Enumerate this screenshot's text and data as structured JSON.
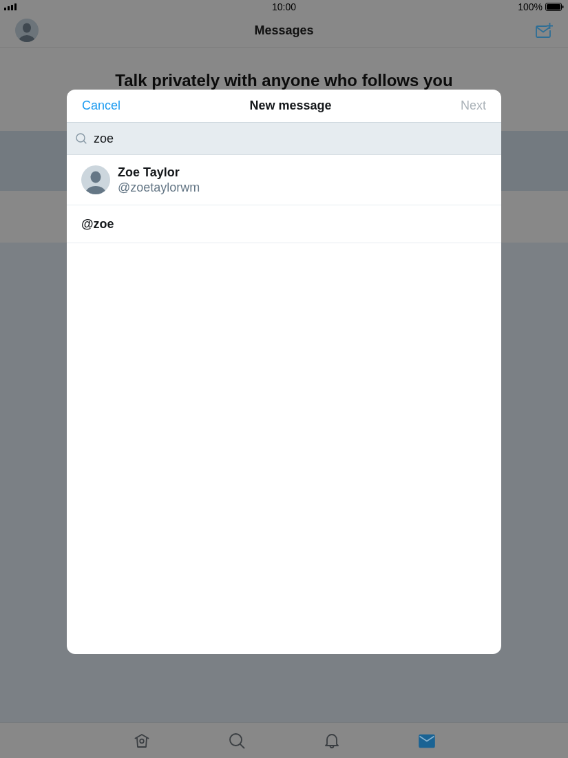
{
  "status_bar": {
    "time": "10:00",
    "battery": "100%"
  },
  "nav_bar": {
    "title": "Messages"
  },
  "background": {
    "heading": "Talk privately with anyone who follows you"
  },
  "modal": {
    "cancel": "Cancel",
    "title": "New message",
    "next": {
      "label": "Next",
      "disabled": true
    },
    "search": {
      "value": "zoe"
    },
    "results": [
      {
        "kind": "user",
        "name": "Zoe Taylor",
        "handle": "@zoetaylorwm"
      },
      {
        "kind": "handle",
        "handle": "@zoe"
      }
    ]
  },
  "tab_bar": {
    "tabs": [
      {
        "selected": false
      },
      {
        "selected": false
      },
      {
        "selected": false
      },
      {
        "selected": true
      }
    ]
  }
}
